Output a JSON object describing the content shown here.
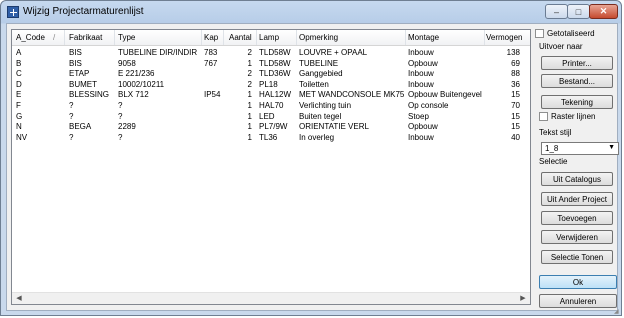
{
  "window": {
    "title": "Wijzig Projectarmaturenlijst"
  },
  "window_controls": {
    "minimize": "–",
    "maximize": "□",
    "close": "✕"
  },
  "table": {
    "columns": [
      "A_Code",
      "Fabrikaat",
      "Type",
      "Kap",
      "Aantal",
      "Lamp",
      "Opmerking",
      "Montage",
      "Vermogen"
    ],
    "sort_indicator": "/",
    "rows": [
      [
        "A",
        "BIS",
        "TUBELINE DIR/INDIR",
        "783",
        "2",
        "TLD58W",
        "LOUVRE + OPAAL",
        "Inbouw",
        "138"
      ],
      [
        "B",
        "BIS",
        "9058",
        "767",
        "1",
        "TLD58W",
        "TUBELINE",
        "Opbouw",
        "69"
      ],
      [
        "C",
        "ETAP",
        "E 221/236",
        "",
        "2",
        "TLD36W",
        "Ganggebied",
        "Inbouw",
        "88"
      ],
      [
        "D",
        "BUMET",
        "10002/10211",
        "",
        "2",
        "PL18",
        "Toiletten",
        "Inbouw",
        "36"
      ],
      [
        "E",
        "BLESSING",
        "BLX 712",
        "IP54",
        "1",
        "HAL12W",
        "MET WANDCONSOLE MK75",
        "Opbouw Buitengevel",
        "15"
      ],
      [
        "F",
        "?",
        "?",
        "",
        "1",
        "HAL70",
        "Verlichting tuin",
        "Op console",
        "70"
      ],
      [
        "G",
        "?",
        "?",
        "",
        "1",
        "LED",
        "Buiten tegel",
        "Stoep",
        "15"
      ],
      [
        "N",
        "BEGA",
        "2289",
        "",
        "1",
        "PL7/9W",
        "ORIENTATIE VERL",
        "Opbouw",
        "15"
      ],
      [
        "NV",
        "?",
        "?",
        "",
        "1",
        "TL36",
        "In overleg",
        "Inbouw",
        "40"
      ]
    ]
  },
  "scrollbar": {
    "left_arrow": "◀",
    "right_arrow": "▶"
  },
  "side": {
    "gelaliseerd_label": "Getotaliseerd",
    "uitvoer_label": "Uitvoer naar",
    "printer_button": "Printer...",
    "bestand_button": "Bestand...",
    "tekening_button": "Tekening",
    "raster_label": "Raster lijnen",
    "tekst_stijl_label": "Tekst stijl",
    "tekst_stijl_value": "1_8",
    "select_arrow": "▼",
    "selectie_label": "Selectie",
    "uit_catalogus_button": "Uit Catalogus",
    "uit_ander_project_button": "Uit Ander Project",
    "toevoegen_button": "Toevoegen",
    "verwijderen_button": "Verwijderen",
    "selectie_tonen_button": "Selectie Tonen",
    "ok_button": "Ok",
    "annuleren_button": "Annuleren"
  }
}
